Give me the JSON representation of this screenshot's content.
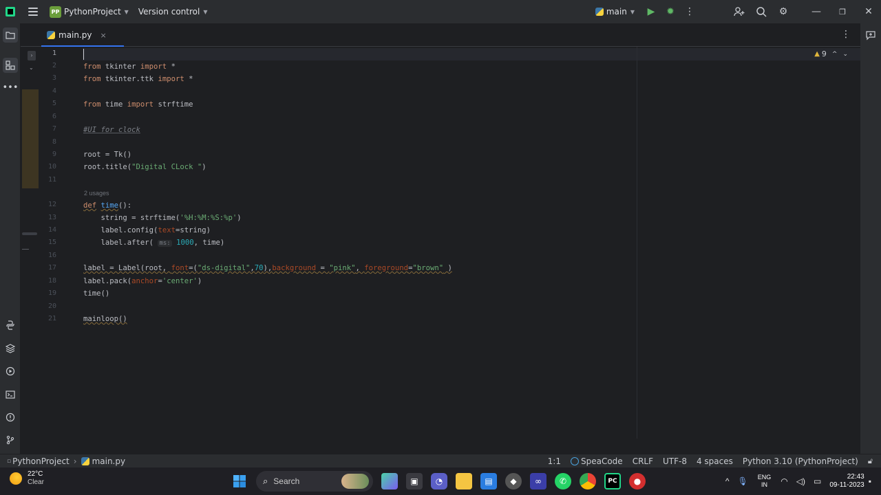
{
  "titlebar": {
    "project_badge": "PP",
    "project_name": "PythonProject",
    "version_control": "Version control",
    "branch": "main"
  },
  "tab": {
    "file_name": "main.py",
    "close_glyph": "×"
  },
  "inspections": {
    "warning_count": "9"
  },
  "editor": {
    "line_numbers": [
      "1",
      "2",
      "3",
      "4",
      "5",
      "6",
      "7",
      "8",
      "9",
      "10",
      "11",
      "12",
      "13",
      "14",
      "15",
      "16",
      "17",
      "18",
      "19",
      "20",
      "21"
    ],
    "usages_hint": "2 usages",
    "param_hint_ms": "ms:"
  },
  "statusbar": {
    "breadcrumb_project": "PythonProject",
    "breadcrumb_file": "main.py",
    "position": "1:1",
    "plugin": "SpeaCode",
    "line_sep": "CRLF",
    "encoding": "UTF-8",
    "indent": "4 spaces",
    "interpreter": "Python 3.10 (PythonProject)"
  },
  "taskbar": {
    "temperature": "22°C",
    "weather": "Clear",
    "search_label": "Search",
    "lang_top": "ENG",
    "lang_bottom": "IN",
    "time": "22:43",
    "date": "09-11-2023"
  },
  "colors": {
    "accent": "#3574f0",
    "keyword": "#cf8e6d",
    "string": "#6aab73",
    "function": "#56a8f5",
    "parameter": "#aa4926"
  }
}
